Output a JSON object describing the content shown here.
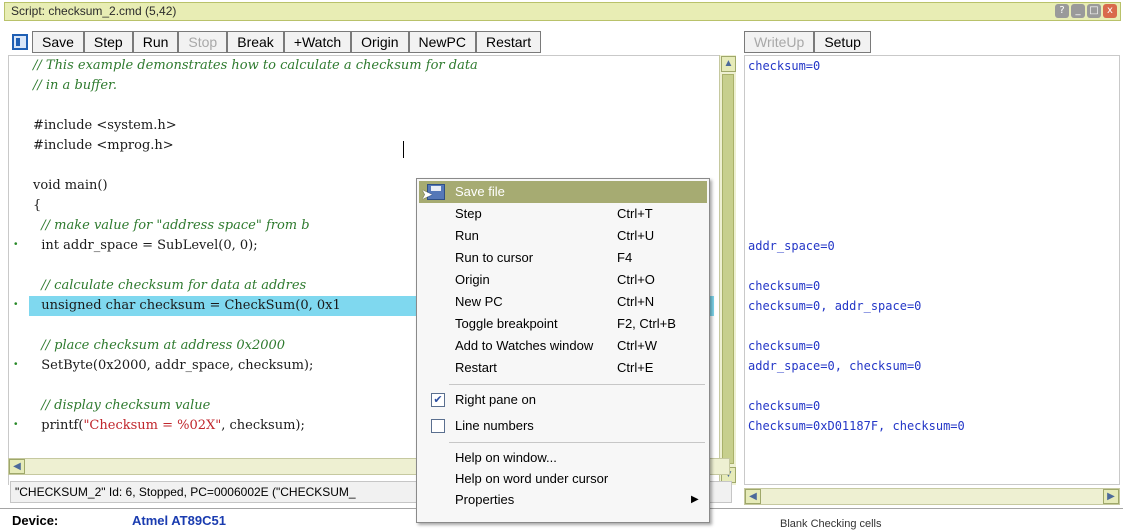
{
  "window": {
    "title": "Script: checksum_2.cmd (5,42)",
    "buttons": [
      "?",
      "_",
      "□",
      "x"
    ]
  },
  "toolbar": {
    "items": [
      {
        "label": "Save",
        "enabled": true
      },
      {
        "label": "Step",
        "enabled": true
      },
      {
        "label": "Run",
        "enabled": true
      },
      {
        "label": "Stop",
        "enabled": false
      },
      {
        "label": "Break",
        "enabled": true
      },
      {
        "label": "+Watch",
        "enabled": true
      },
      {
        "label": "Origin",
        "enabled": true
      },
      {
        "label": "NewPC",
        "enabled": true
      },
      {
        "label": "Restart",
        "enabled": true
      }
    ]
  },
  "right_toolbar": {
    "items": [
      {
        "label": "WriteUp",
        "enabled": false
      },
      {
        "label": "Setup",
        "enabled": true
      }
    ]
  },
  "code": {
    "lines": [
      {
        "text": "// This example demonstrates how to calculate a checksum for data",
        "kind": "comment",
        "mark": false
      },
      {
        "text": "// in a buffer.",
        "kind": "comment",
        "mark": false
      },
      {
        "text": "",
        "kind": "plain",
        "mark": false
      },
      {
        "text": "#include <system.h>",
        "kind": "plain",
        "mark": false
      },
      {
        "text": "#include <mprog.h>",
        "kind": "plain",
        "mark": false
      },
      {
        "text": "",
        "kind": "plain",
        "mark": false
      },
      {
        "text": "void main()",
        "kind": "plain",
        "mark": false
      },
      {
        "text": "{",
        "kind": "plain",
        "mark": false
      },
      {
        "text": "  // make value for \"address space\" from b",
        "kind": "comment",
        "mark": false
      },
      {
        "text": "  int addr_space = SubLevel(0, 0);",
        "kind": "plain",
        "mark": true
      },
      {
        "text": "",
        "kind": "plain",
        "mark": false
      },
      {
        "text": "  // calculate checksum for data at addres",
        "kind": "comment",
        "mark": false
      },
      {
        "text": "  unsigned char checksum = CheckSum(0, 0x1",
        "kind": "highlight",
        "mark": true
      },
      {
        "text": "",
        "kind": "plain",
        "mark": false
      },
      {
        "text": "  // place checksum at address 0x2000",
        "kind": "comment",
        "mark": false
      },
      {
        "text": "  SetByte(0x2000, addr_space, checksum);",
        "kind": "plain",
        "mark": true
      },
      {
        "text": "",
        "kind": "plain",
        "mark": false
      },
      {
        "text": "  // display checksum value",
        "kind": "comment",
        "mark": false
      },
      {
        "text_prefix": "  printf(",
        "text_str": "\"Checksum = %02X\"",
        "text_suffix": ", checksum);",
        "kind": "printf",
        "mark": true
      }
    ]
  },
  "watch": {
    "lines": [
      {
        "row": 0,
        "text": "checksum=0"
      },
      {
        "row": 9,
        "text": "addr_space=0"
      },
      {
        "row": 11,
        "text": "checksum=0"
      },
      {
        "row": 12,
        "text": "checksum=0, addr_space=0"
      },
      {
        "row": 14,
        "text": "checksum=0"
      },
      {
        "row": 15,
        "text": "addr_space=0, checksum=0"
      },
      {
        "row": 17,
        "text": "checksum=0"
      },
      {
        "row": 18,
        "text": "Checksum=0xD01187F, checksum=0"
      }
    ]
  },
  "status": {
    "text": "\"CHECKSUM_2\" Id: 6, Stopped, PC=0006002E (\"CHECKSUM_"
  },
  "device": {
    "label": "Device:",
    "value": "Atmel AT89C51",
    "right_text": "Blank Checking cells"
  },
  "context_menu": {
    "items": [
      {
        "label": "Save file",
        "shortcut": "",
        "selected": true,
        "icon": "save-icon"
      },
      {
        "label": "Step",
        "shortcut": "Ctrl+T"
      },
      {
        "label": "Run",
        "shortcut": "Ctrl+U"
      },
      {
        "label": "Run to cursor",
        "shortcut": "F4"
      },
      {
        "label": "Origin",
        "shortcut": "Ctrl+O"
      },
      {
        "label": "New PC",
        "shortcut": "Ctrl+N"
      },
      {
        "label": "Toggle breakpoint",
        "shortcut": "F2, Ctrl+B"
      },
      {
        "label": "Add to Watches window",
        "shortcut": "Ctrl+W"
      },
      {
        "label": "Restart",
        "shortcut": "Ctrl+E"
      }
    ],
    "checks": [
      {
        "label": "Right pane on",
        "checked": true
      },
      {
        "label": "Line numbers",
        "checked": false
      }
    ],
    "help": [
      {
        "label": "Help on window..."
      },
      {
        "label": "Help on word under cursor"
      },
      {
        "label": "Properties",
        "submenu": true
      }
    ]
  },
  "colors": {
    "highlight": "#7fd8ef",
    "menu_selection": "#a6ab72",
    "watch_text": "#2336c7",
    "comment": "#2e7a2e",
    "string": "#c0262c"
  }
}
